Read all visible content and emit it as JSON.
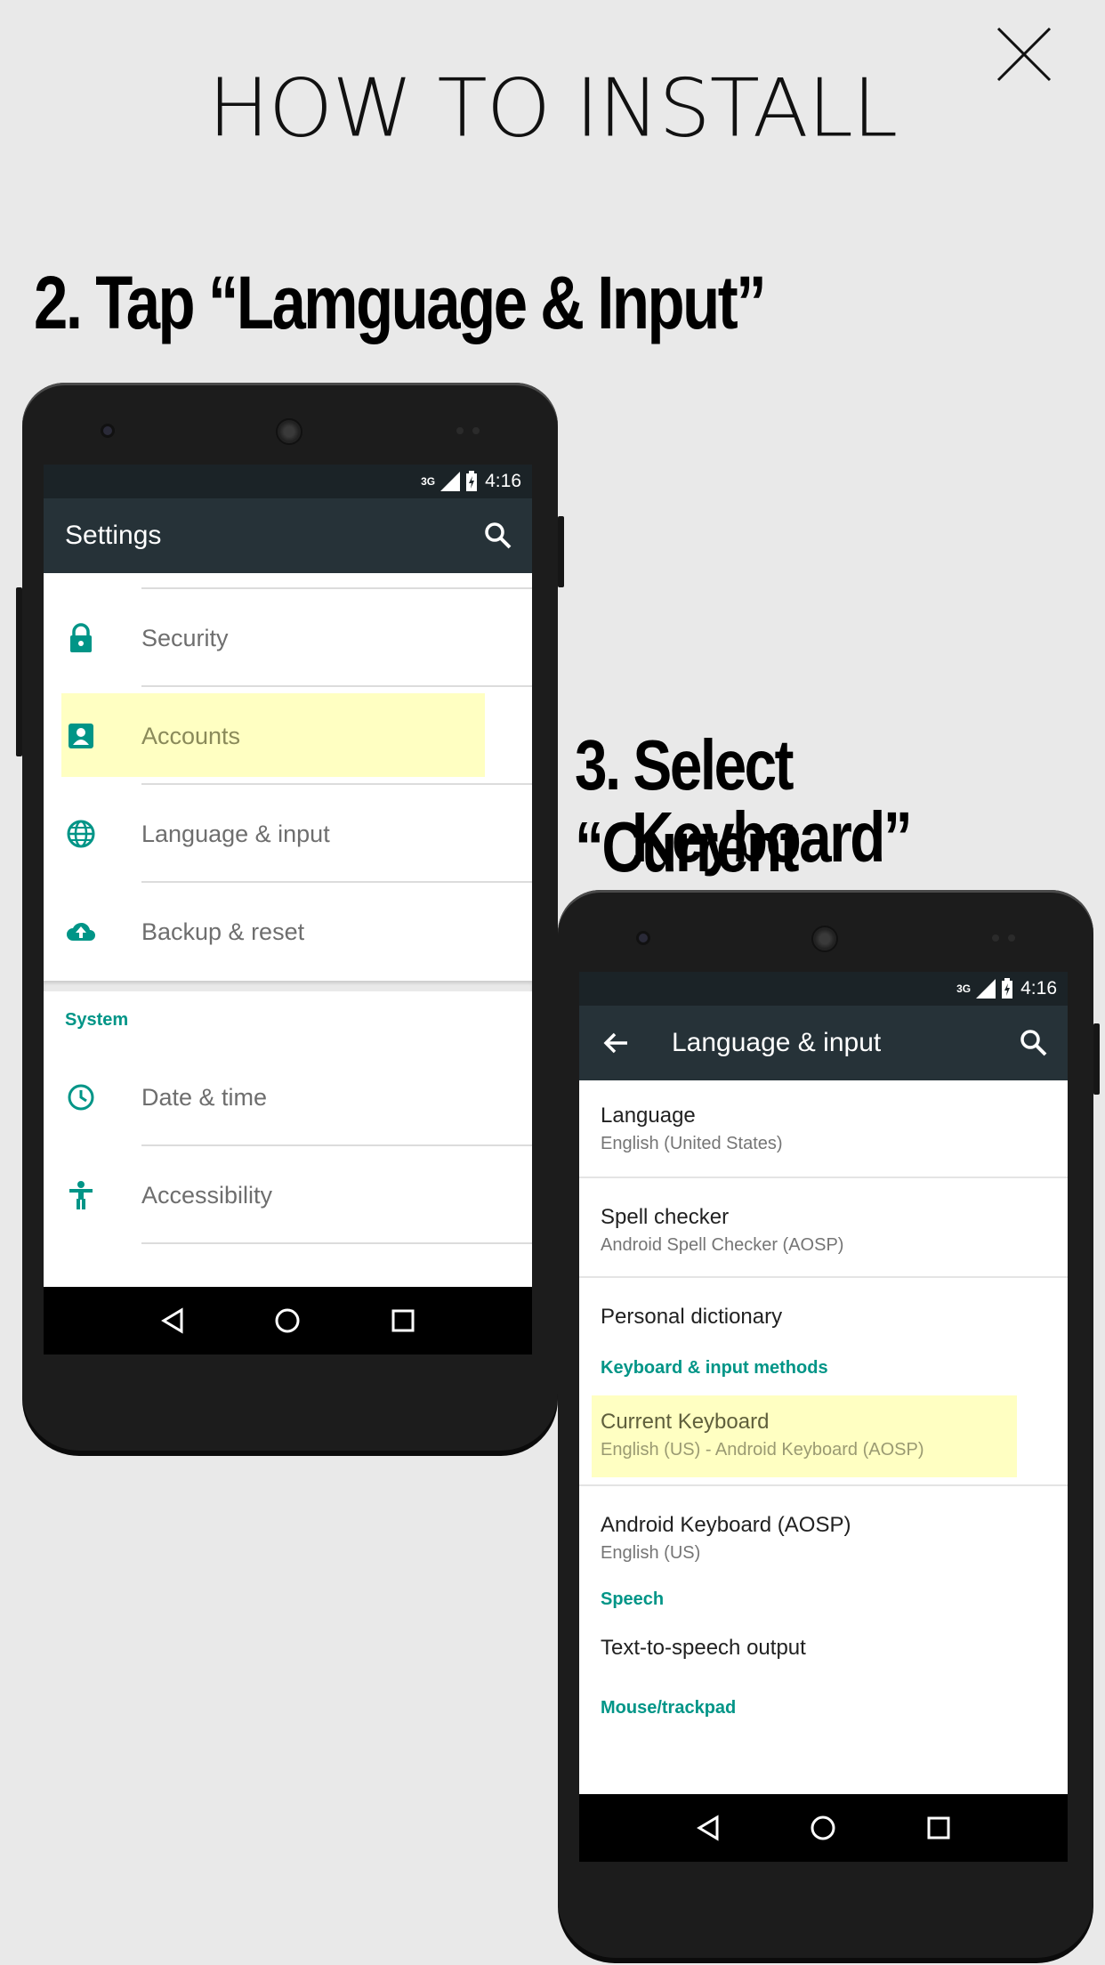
{
  "header": {
    "title": "HOW TO INSTALL",
    "close_icon": "close-icon"
  },
  "steps": {
    "step2": "2. Tap “Lamguage & Input”",
    "step3_line1": "3. Select “Current",
    "step3_line2": "Keyboard”"
  },
  "phone1": {
    "status_time": "4:16",
    "status_network": "3G",
    "appbar_title": "Settings",
    "items": [
      {
        "label": "Security",
        "icon": "lock-icon"
      },
      {
        "label": "Accounts",
        "icon": "account-icon",
        "highlighted": true
      },
      {
        "label": "Language & input",
        "icon": "globe-icon"
      },
      {
        "label": "Backup & reset",
        "icon": "cloud-upload-icon"
      }
    ],
    "section": "System",
    "system_items": [
      {
        "label": "Date & time",
        "icon": "clock-icon"
      },
      {
        "label": "Accessibility",
        "icon": "accessibility-icon"
      }
    ]
  },
  "phone2": {
    "status_time": "4:16",
    "status_network": "3G",
    "appbar_title": "Language & input",
    "items": [
      {
        "primary": "Language",
        "secondary": "English (United States)"
      },
      {
        "primary": "Spell checker",
        "secondary": "Android Spell Checker (AOSP)"
      },
      {
        "primary": "Personal dictionary",
        "secondary": ""
      }
    ],
    "section_keyboard": "Keyboard & input methods",
    "keyboard_items": [
      {
        "primary": "Current Keyboard",
        "secondary": "English (US) - Android Keyboard (AOSP)",
        "highlighted": true
      },
      {
        "primary": "Android Keyboard (AOSP)",
        "secondary": "English (US)"
      }
    ],
    "section_speech": "Speech",
    "speech_item": "Text-to-speech output",
    "section_mouse": "Mouse/trackpad"
  },
  "colors": {
    "accent": "#009587",
    "appbar": "#263238",
    "highlight": "#ffffc2"
  }
}
